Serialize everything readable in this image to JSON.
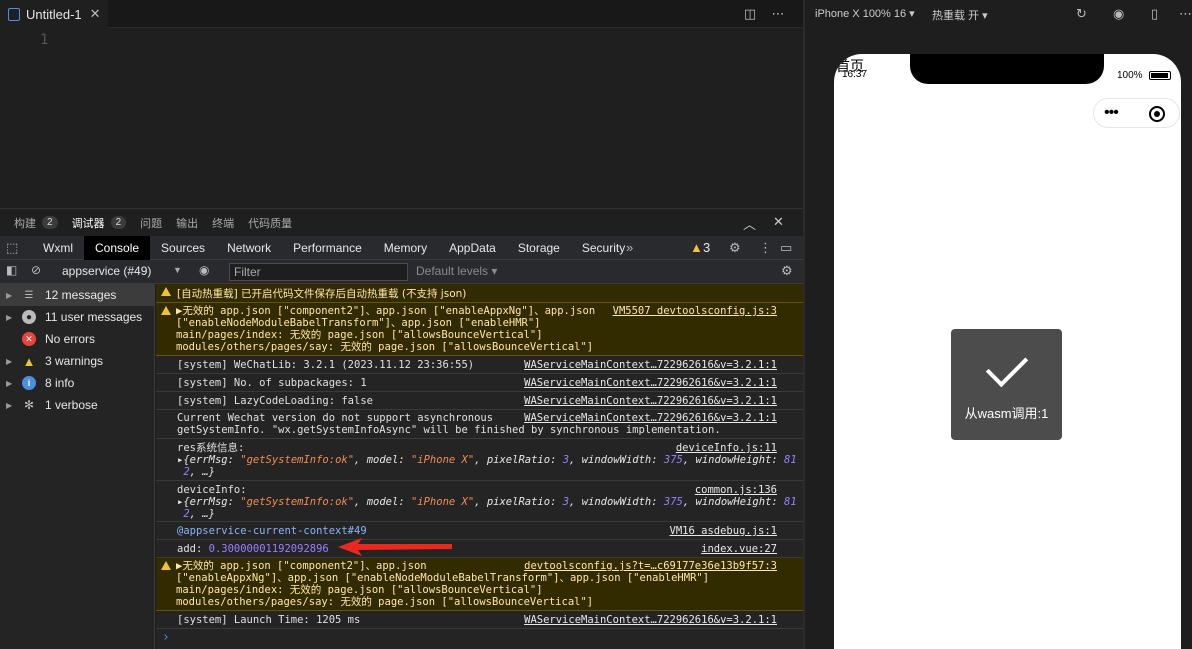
{
  "editor": {
    "tab_label": "Untitled-1",
    "line_number": "1"
  },
  "panel_tabs": [
    {
      "label": "构建",
      "badge": "2"
    },
    {
      "label": "调试器",
      "badge": "2"
    },
    {
      "label": "问题",
      "badge": ""
    },
    {
      "label": "输出",
      "badge": ""
    },
    {
      "label": "终端",
      "badge": ""
    },
    {
      "label": "代码质量",
      "badge": ""
    }
  ],
  "devtools_tabs": [
    "Wxml",
    "Console",
    "Sources",
    "Network",
    "Performance",
    "Memory",
    "AppData",
    "Storage",
    "Security"
  ],
  "devtools_warning_count": "3",
  "console_toolbar": {
    "context": "appservice (#49)",
    "filter_placeholder": "Filter",
    "levels": "Default levels"
  },
  "sidebar": [
    {
      "label": "12 messages",
      "icon": "list-icon"
    },
    {
      "label": "11 user messages",
      "icon": "user-icon"
    },
    {
      "label": "No errors",
      "icon": "error-icon"
    },
    {
      "label": "3 warnings",
      "icon": "warning-icon"
    },
    {
      "label": "8 info",
      "icon": "info-icon"
    },
    {
      "label": "1 verbose",
      "icon": "verbose-icon"
    }
  ],
  "console_messages": {
    "m1": {
      "text": "[自动热重载] 已开启代码文件保存后自动热重载 (不支持 json)"
    },
    "m2": {
      "text": "▶无效的 app.json [\"component2\"]、app.json [\"enableAppxNg\"]、app.json\n[\"enableNodeModuleBabelTransform\"]、app.json [\"enableHMR\"]\nmain/pages/index: 无效的 page.json [\"allowsBounceVertical\"]\nmodules/others/pages/say: 无效的 page.json [\"allowsBounceVertical\"]",
      "source": "VM5507 devtoolsconfig.js:3"
    },
    "m3": {
      "text": "[system] WeChatLib: 3.2.1 (2023.11.12 23:36:55)",
      "source": "WAServiceMainContext…722962616&v=3.2.1:1"
    },
    "m4": {
      "text": "[system] No. of subpackages: 1",
      "source": "WAServiceMainContext…722962616&v=3.2.1:1"
    },
    "m5": {
      "text": "[system] LazyCodeLoading: false",
      "source": "WAServiceMainContext…722962616&v=3.2.1:1"
    },
    "m6": {
      "text": "Current Wechat version do not support asynchronous\ngetSystemInfo. \"wx.getSystemInfoAsync\" will be finished by synchronous implementation.",
      "source": "WAServiceMainContext…722962616&v=3.2.1:1"
    },
    "m7": {
      "label": "res系统信息:",
      "source": "deviceInfo.js:11"
    },
    "m8": {
      "label": "deviceInfo:",
      "source": "common.js:136"
    },
    "obj": {
      "errMsg_key": "errMsg",
      "errMsg_val": "\"getSystemInfo:ok\"",
      "model_key": "model",
      "model_val": "\"iPhone X\"",
      "pixelRatio_key": "pixelRatio",
      "pixelRatio_val": "3",
      "windowWidth_key": "windowWidth",
      "windowWidth_val": "375",
      "windowHeight_key": "windowHeight",
      "windowHeight_val_1": "81",
      "windowHeight_val_2": "2"
    },
    "m9": {
      "text": "@appservice-current-context#49",
      "source": "VM16 asdebug.js:1"
    },
    "m10": {
      "label": "add:",
      "value": "0.30000001192092896",
      "source": "index.vue:27"
    },
    "m11": {
      "text": "▶无效的 app.json [\"component2\"]、app.json\n[\"enableAppxNg\"]、app.json [\"enableNodeModuleBabelTransform\"]、app.json [\"enableHMR\"]\nmain/pages/index: 无效的 page.json [\"allowsBounceVertical\"]\nmodules/others/pages/say: 无效的 page.json [\"allowsBounceVertical\"]",
      "source": "devtoolsconfig.js?t=…c69177e36e13b9f57:3"
    },
    "m12": {
      "text": "[system] Launch Time: 1205 ms",
      "source": "WAServiceMainContext…722962616&v=3.2.1:1"
    },
    "prompt": "›"
  },
  "simulator": {
    "device": "iPhone X 100% 16 ▾",
    "hot_reload": "热重载 开 ▾",
    "page_title": "首页",
    "time": "16:37",
    "battery": "100%",
    "toast_text": "从wasm调用:1"
  },
  "colors": {
    "warning": "#f2c233",
    "error": "#e8453c",
    "info": "#4b8fe0",
    "annotation_arrow": "#e8291f"
  }
}
